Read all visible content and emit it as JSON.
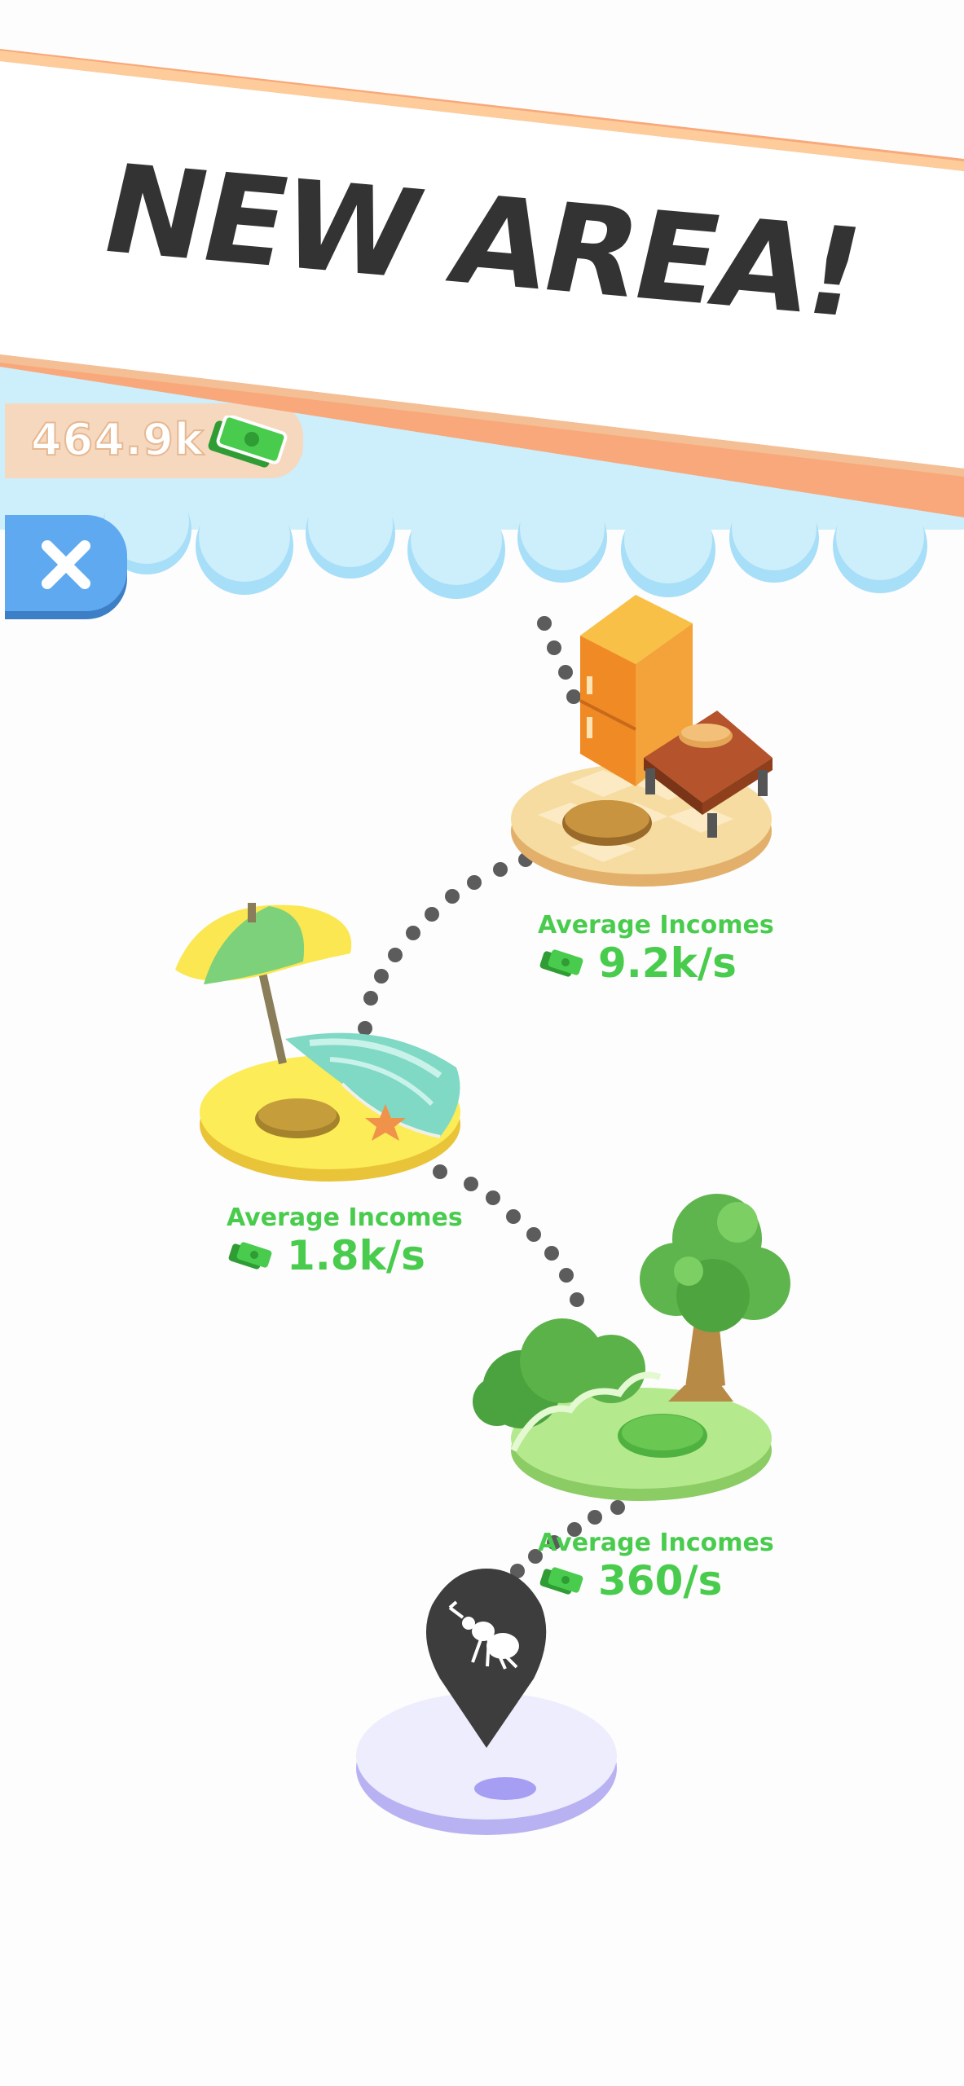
{
  "banner": {
    "title": "NEW AREA!"
  },
  "currency": {
    "amount": "464.9k",
    "icon": "cash-icon"
  },
  "close": {
    "icon": "close-icon"
  },
  "areas": [
    {
      "name": "Kitchen",
      "income_label": "Average Incomes",
      "income_value": "9.2k/s",
      "theme": "kitchen-island"
    },
    {
      "name": "Beach",
      "income_label": "Average Incomes",
      "income_value": "1.8k/s",
      "theme": "beach-island"
    },
    {
      "name": "Forest",
      "income_label": "Average Incomes",
      "income_value": "360/s",
      "theme": "forest-island"
    }
  ],
  "current_location": {
    "icon": "ant-pin-icon"
  },
  "colors": {
    "income_green": "#49cc4d",
    "banner_orange": "#f8a87a",
    "close_blue": "#5ea9f0",
    "sky_blue": "#cdeefb"
  }
}
